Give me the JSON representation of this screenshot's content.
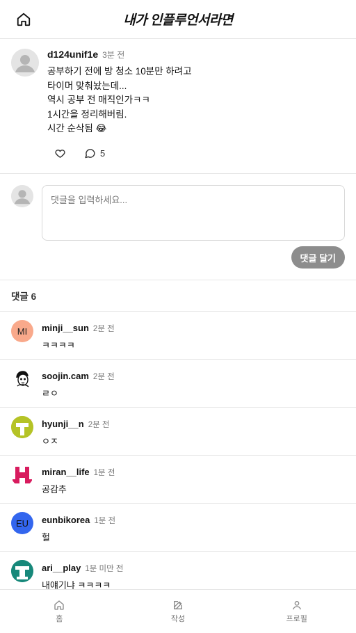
{
  "header": {
    "title": "내가 인플루언서라면"
  },
  "post": {
    "username": "d124unif1e",
    "time": "3분 전",
    "lines": [
      "공부하기 전에 방 청소 10분만 하려고",
      "타이머 맞춰놨는데...",
      "역시 공부 전 매직인가ㅋㅋ",
      "1시간을 정리해버림.",
      "시간 순삭됨 😂"
    ],
    "comment_count": "5"
  },
  "comment_form": {
    "placeholder": "댓글을 입력하세요...",
    "submit_label": "댓글 달기"
  },
  "comments_header": {
    "label": "댓글 6"
  },
  "comments": [
    {
      "username": "minji__sun",
      "time": "2분 전",
      "text": "ㅋㅋㅋㅋ",
      "avatar_initials": "MI",
      "avatar_color": "#f9a98b",
      "avatar_icon": "initials"
    },
    {
      "username": "soojin.cam",
      "time": "2분 전",
      "text": "ㄹㅇ",
      "avatar_initials": "",
      "avatar_color": "#ffffff",
      "avatar_icon": "face-sketch-icon"
    },
    {
      "username": "hyunji__n",
      "time": "2분 전",
      "text": "ㅇㅈ",
      "avatar_initials": "",
      "avatar_color": "#b5c326",
      "avatar_icon": "pattern-avatar-icon"
    },
    {
      "username": "miran__life",
      "time": "1분 전",
      "text": "공감추",
      "avatar_initials": "",
      "avatar_color": "#d81b5e",
      "avatar_icon": "pattern-avatar-icon"
    },
    {
      "username": "eunbikorea",
      "time": "1분 전",
      "text": "헐",
      "avatar_initials": "EU",
      "avatar_color": "#3366ee",
      "avatar_icon": "initials"
    },
    {
      "username": "ari__play",
      "time": "1분 미만 전",
      "text": "내얘기냐 ㅋㅋㅋㅋ",
      "avatar_initials": "",
      "avatar_color": "#17887a",
      "avatar_icon": "pattern-avatar-icon"
    }
  ],
  "bottom_nav": [
    {
      "label": "홈",
      "icon": "home-icon"
    },
    {
      "label": "작성",
      "icon": "edit-icon"
    },
    {
      "label": "프로필",
      "icon": "user-icon"
    }
  ]
}
